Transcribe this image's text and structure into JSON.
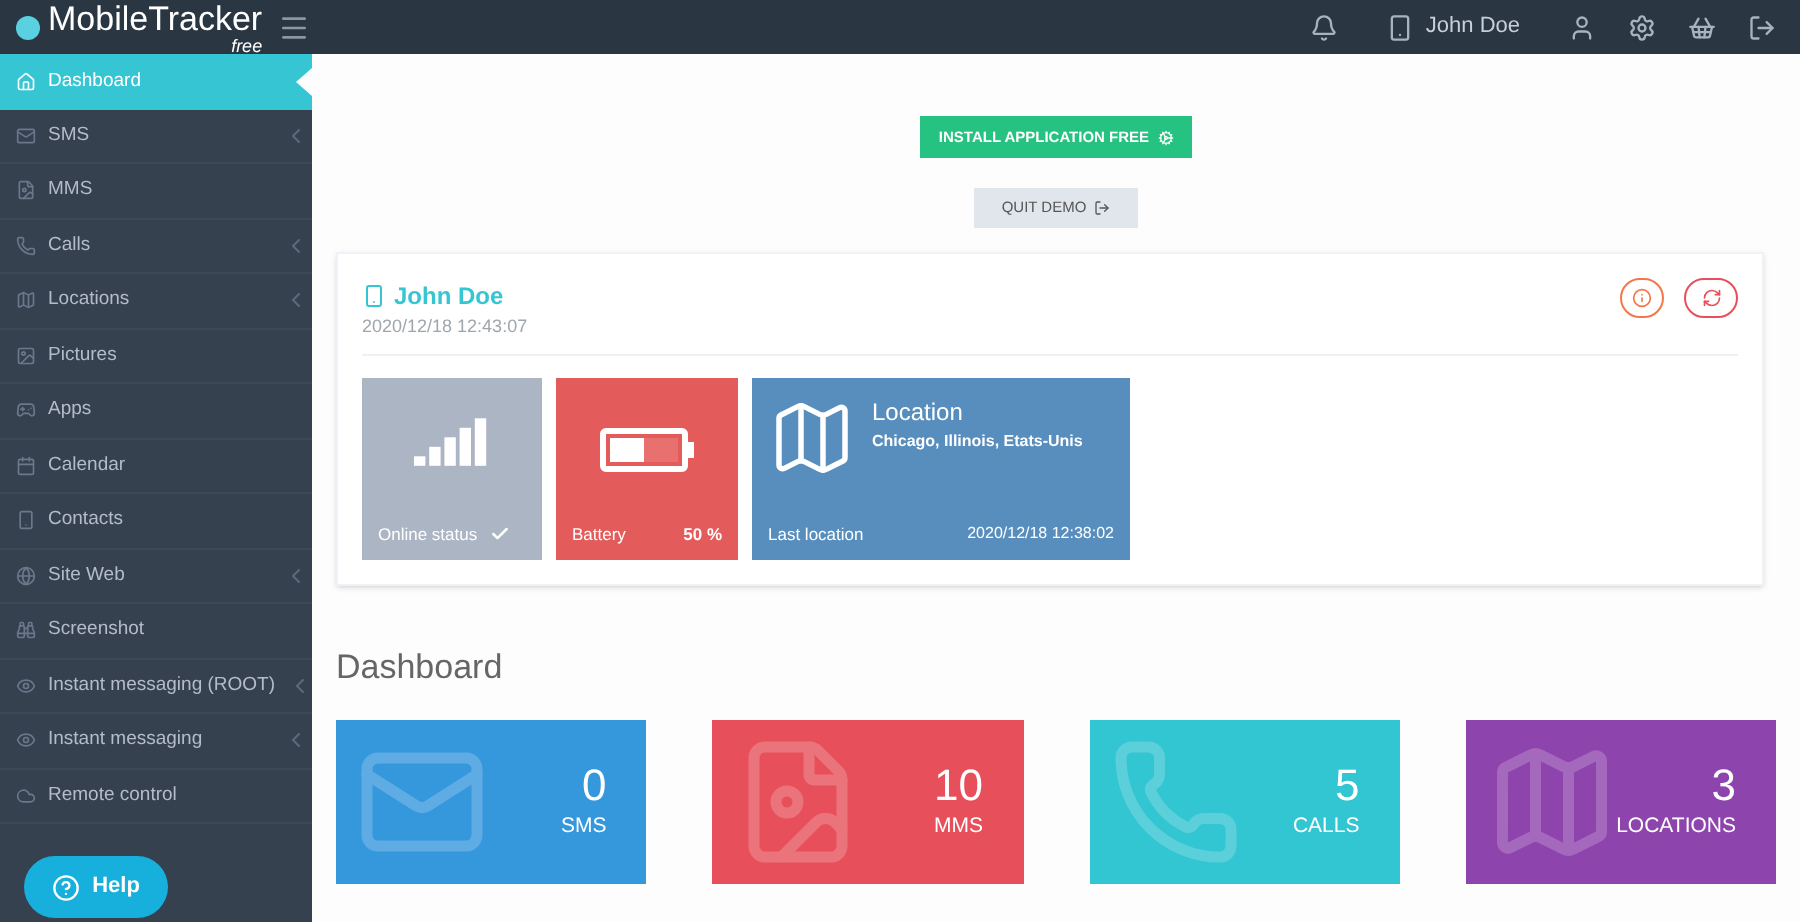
{
  "topbar": {
    "logo_text": "MobileTracker",
    "logo_sub": "free",
    "user": "John Doe"
  },
  "sidebar": {
    "items": [
      {
        "label": "Dashboard",
        "selected": true,
        "has_submenu": false
      },
      {
        "label": "SMS",
        "selected": false,
        "has_submenu": true
      },
      {
        "label": "MMS",
        "selected": false,
        "has_submenu": false
      },
      {
        "label": "Calls",
        "selected": false,
        "has_submenu": true
      },
      {
        "label": "Locations",
        "selected": false,
        "has_submenu": true
      },
      {
        "label": "Pictures",
        "selected": false,
        "has_submenu": false
      },
      {
        "label": "Apps",
        "selected": false,
        "has_submenu": false
      },
      {
        "label": "Calendar",
        "selected": false,
        "has_submenu": false
      },
      {
        "label": "Contacts",
        "selected": false,
        "has_submenu": false
      },
      {
        "label": "Site Web",
        "selected": false,
        "has_submenu": true
      },
      {
        "label": "Screenshot",
        "selected": false,
        "has_submenu": false
      },
      {
        "label": "Instant messaging (ROOT)",
        "selected": false,
        "has_submenu": true
      },
      {
        "label": "Instant messaging",
        "selected": false,
        "has_submenu": true
      },
      {
        "label": "Remote control",
        "selected": false,
        "has_submenu": false
      }
    ]
  },
  "help_button": "Help",
  "install_button": "INSTALL APPLICATION FREE",
  "quit_button": "QUIT DEMO",
  "device": {
    "name": "John Doe",
    "timestamp": "2020/12/18 12:43:07",
    "online": {
      "label": "Online status"
    },
    "battery": {
      "label": "Battery",
      "reading": "50 %",
      "level": 0.5
    },
    "location": {
      "title": "Location",
      "place": "Chicago, Illinois, Etats-Unis",
      "label": "Last location",
      "timestamp": "2020/12/18 12:38:02"
    }
  },
  "dashboard": {
    "title": "Dashboard",
    "tiles": [
      {
        "kind": "sms",
        "count": "0",
        "label": "SMS",
        "color": "#3598dc"
      },
      {
        "kind": "mms",
        "count": "10",
        "label": "MMS",
        "color": "#e7505a"
      },
      {
        "kind": "calls",
        "count": "5",
        "label": "CALLS",
        "color": "#32c5d2"
      },
      {
        "kind": "locations",
        "count": "3",
        "label": "LOCATIONS",
        "color": "#8e44ad"
      }
    ]
  }
}
